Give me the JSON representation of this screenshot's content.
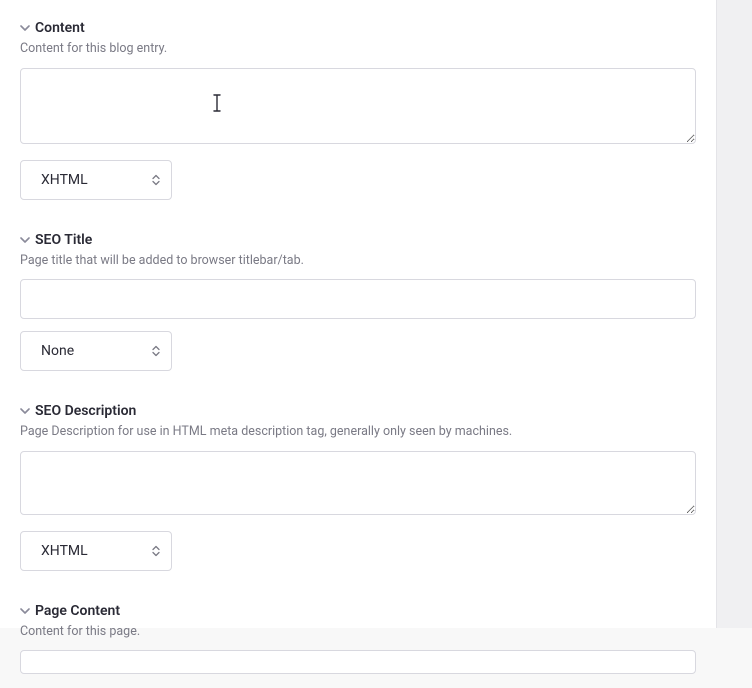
{
  "sections": {
    "content": {
      "title": "Content",
      "description": "Content for this blog entry.",
      "value": "",
      "format": "XHTML"
    },
    "seoTitle": {
      "title": "SEO Title",
      "description": "Page title that will be added to browser titlebar/tab.",
      "value": "",
      "format": "None"
    },
    "seoDescription": {
      "title": "SEO Description",
      "description": "Page Description for use in HTML meta description tag, generally only seen by machines.",
      "value": "",
      "format": "XHTML"
    },
    "pageContent": {
      "title": "Page Content",
      "description": "Content for this page.",
      "value": ""
    }
  }
}
